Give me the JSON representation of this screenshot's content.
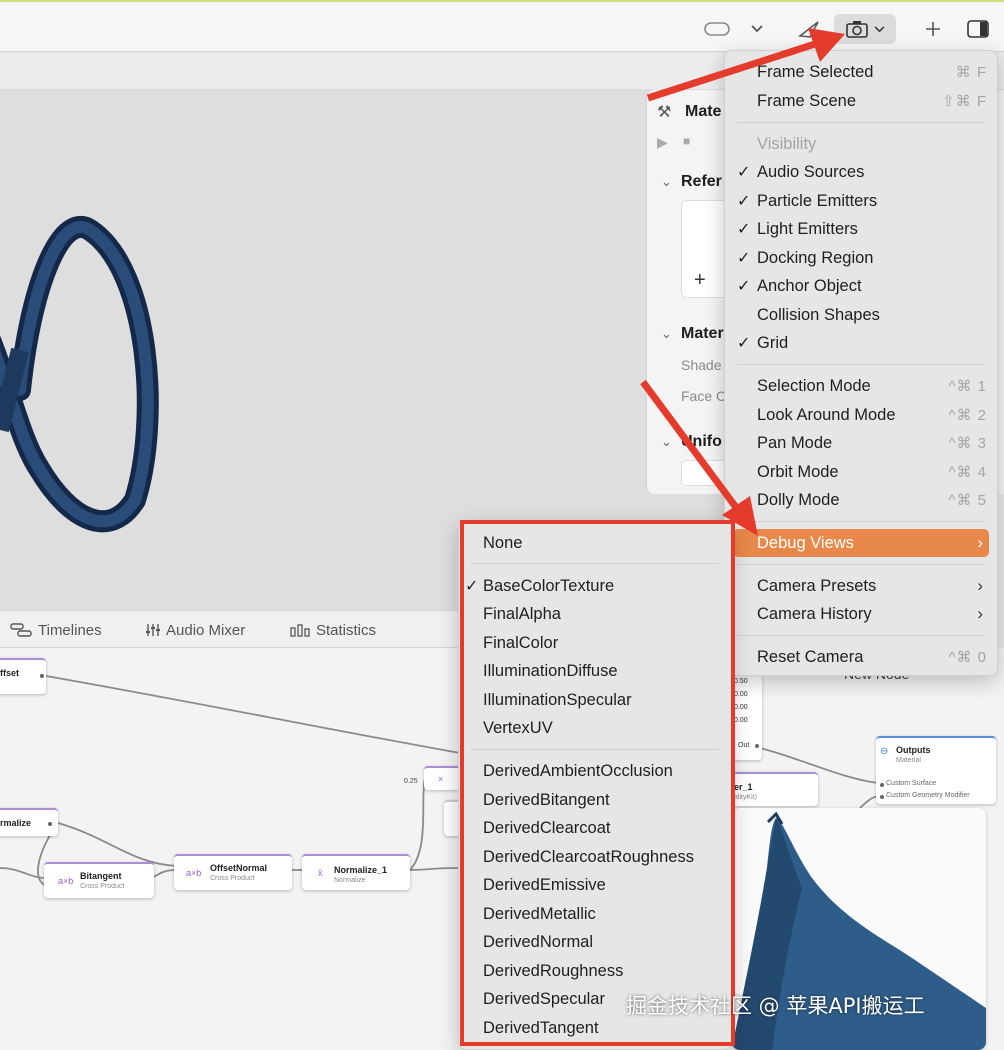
{
  "toolbar": {
    "icons": [
      "vr-headset-icon",
      "chevron-down-icon",
      "send-icon",
      "camera-icon",
      "chevron-down-icon",
      "plus-icon",
      "sidebar-icon"
    ]
  },
  "inspector": {
    "title": "Mate",
    "section_references": "Refer",
    "section_material": "Mater",
    "shader_label": "Shade",
    "face_label": "Face C",
    "section_uniforms": "Unifo",
    "add_symbol": "+"
  },
  "bottom_tabs": [
    {
      "label": "Timelines",
      "icon": "timelines-icon"
    },
    {
      "label": "Audio Mixer",
      "icon": "mixer-icon"
    },
    {
      "label": "Statistics",
      "icon": "statistics-icon"
    }
  ],
  "graph": {
    "nodes": {
      "offset": {
        "title": "ffset"
      },
      "normalize_left": {
        "title": "rmalize"
      },
      "bitangent": {
        "title": "Bitangent",
        "subtitle": "Cross Product",
        "icon": "a×b"
      },
      "offset_normal": {
        "title": "OffsetNormal",
        "subtitle": "Cross Product",
        "icon": "a×b"
      },
      "normalize_1": {
        "title": "Normalize_1",
        "subtitle": "Normalize",
        "icon": "x̂"
      },
      "multiply": {
        "icon": "×"
      },
      "outputs": {
        "title": "Outputs",
        "subtitle": "Material",
        "ports": [
          "Custom Surface",
          "Custom Geometry Modifier"
        ]
      },
      "partial_node": {
        "title": "er_1",
        "subtitle": "alityKit)"
      },
      "values_node": {
        "values": [
          "0.50",
          "0.00",
          "0.00",
          "0.00"
        ],
        "out_label": "Out"
      }
    },
    "edge_value": "0.25",
    "new_node_label": "New Node"
  },
  "camera_menu": {
    "items": [
      {
        "label": "Frame Selected",
        "shortcut": "⌘ F"
      },
      {
        "label": "Frame Scene",
        "shortcut": "⇧⌘ F"
      },
      {
        "label": "Visibility",
        "disabled": true
      },
      {
        "label": "Audio Sources",
        "checked": true
      },
      {
        "label": "Particle Emitters",
        "checked": true
      },
      {
        "label": "Light Emitters",
        "checked": true
      },
      {
        "label": "Docking Region",
        "checked": true
      },
      {
        "label": "Anchor Object",
        "checked": true
      },
      {
        "label": "Collision Shapes",
        "checked": false
      },
      {
        "label": "Grid",
        "checked": true
      },
      {
        "label": "Selection Mode",
        "shortcut": "^⌘ 1"
      },
      {
        "label": "Look Around Mode",
        "shortcut": "^⌘ 2"
      },
      {
        "label": "Pan Mode",
        "shortcut": "^⌘ 3"
      },
      {
        "label": "Orbit Mode",
        "shortcut": "^⌘ 4"
      },
      {
        "label": "Dolly Mode",
        "shortcut": "^⌘ 5"
      },
      {
        "label": "Debug Views",
        "highlighted": true
      },
      {
        "label": "Camera Presets"
      },
      {
        "label": "Camera History"
      },
      {
        "label": "Reset Camera",
        "shortcut": "^⌘ 0"
      }
    ],
    "check_glyph": "✓",
    "submenu_arrow": "›"
  },
  "debug_views_menu": {
    "items": [
      {
        "label": "None"
      },
      {
        "label": "BaseColorTexture",
        "checked": true
      },
      {
        "label": "FinalAlpha"
      },
      {
        "label": "FinalColor"
      },
      {
        "label": "IlluminationDiffuse"
      },
      {
        "label": "IlluminationSpecular"
      },
      {
        "label": "VertexUV"
      },
      {
        "label": "DerivedAmbientOcclusion"
      },
      {
        "label": "DerivedBitangent"
      },
      {
        "label": "DerivedClearcoat"
      },
      {
        "label": "DerivedClearcoatRoughness"
      },
      {
        "label": "DerivedEmissive"
      },
      {
        "label": "DerivedMetallic"
      },
      {
        "label": "DerivedNormal"
      },
      {
        "label": "DerivedRoughness"
      },
      {
        "label": "DerivedSpecular"
      },
      {
        "label": "DerivedTangent"
      }
    ]
  },
  "watermark": "掘金技术社区 @ 苹果API搬运工",
  "colors": {
    "highlight": "#e8884a",
    "annotation_red": "#e53b2c",
    "torus": "#1e3a5f",
    "preview_mesh": "#2f5d8a"
  }
}
